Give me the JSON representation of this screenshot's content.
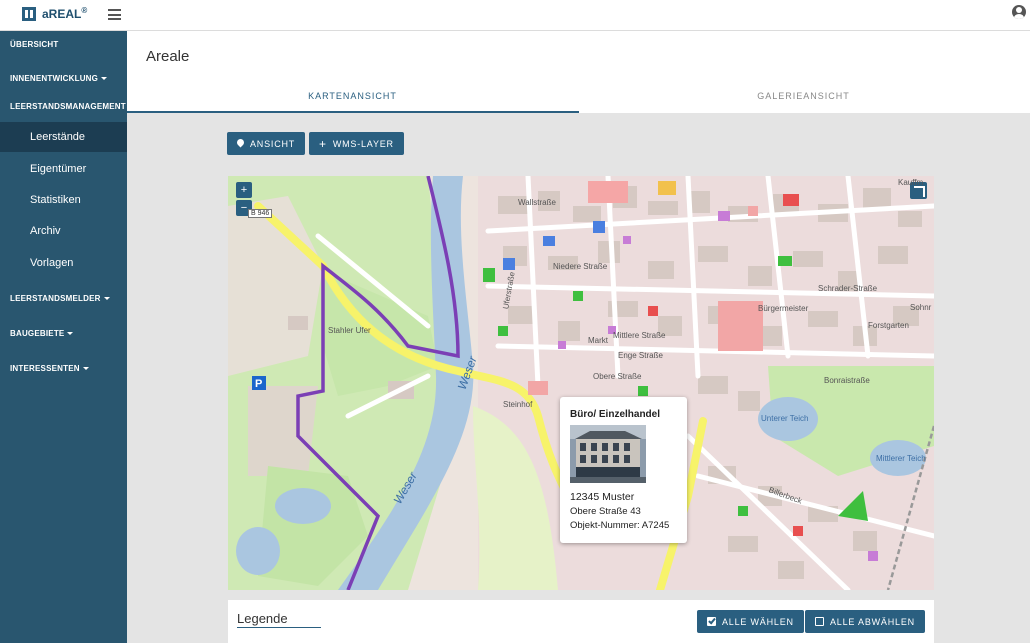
{
  "brand": {
    "name": "aREAL",
    "mark": "®"
  },
  "sidebar": {
    "sections": [
      {
        "label": "ÜBERSICHT"
      },
      {
        "label": "INNENENTWICKLUNG"
      },
      {
        "label": "LEERSTANDSMANAGEMENT"
      },
      {
        "label": "LEERSTANDSMELDER"
      },
      {
        "label": "BAUGEBIETE"
      },
      {
        "label": "INTERESSENTEN"
      }
    ],
    "items": [
      {
        "label": "Leerstände",
        "active": true
      },
      {
        "label": "Eigentümer"
      },
      {
        "label": "Statistiken"
      },
      {
        "label": "Archiv"
      },
      {
        "label": "Vorlagen"
      }
    ]
  },
  "page": {
    "title": "Areale"
  },
  "tabs": [
    {
      "label": "KARTENANSICHT",
      "active": true
    },
    {
      "label": "GALERIEANSICHT"
    }
  ],
  "toolbar": {
    "view_label": "ANSICHT",
    "wms_label": "WMS-LAYER"
  },
  "map": {
    "zoom_in": "+",
    "zoom_out": "−",
    "road_number": "B 946",
    "labels": {
      "stahler_ufer": "Stahler Ufer",
      "weser1": "Weser",
      "weser2": "Weser",
      "markt": "Markt",
      "enge_strasse": "Enge Straße",
      "obere_strasse": "Obere Straße",
      "mittlere_strasse": "Mittlere Straße",
      "wall": "Wallstraße",
      "steinhof": "Steinhof",
      "unterer_teich": "Unterer Teich",
      "mittlerer_teich": "Mittlerer Teich",
      "bonrai": "Bonraistraße",
      "forstgarten": "Forstgarten",
      "sohnr": "Sohnr",
      "kauff": "Kauffm",
      "billerbeck": "Billerbeck",
      "schrader": "Schrader-Straße",
      "buergermeister": "Bürgermeister",
      "niedere": "Niedere Straße",
      "uferstrasse": "Uferstraße"
    },
    "colors": {
      "water": "#aac6e0",
      "park": "#cdebb0",
      "building": "#d9d0c9",
      "residential": "#e8d8d8",
      "boundary": "#7b3fb5",
      "main_road": "#f7f36a"
    }
  },
  "popup": {
    "title": "Büro/ Einzelhandel",
    "city": "12345 Muster",
    "street": "Obere Straße 43",
    "object_number": "Objekt-Nummer: A7245"
  },
  "legend": {
    "title": "Legende",
    "select_all": "ALLE WÄHLEN",
    "deselect_all": "ALLE ABWÄHLEN"
  },
  "theme": {
    "primary": "#2a5f80",
    "sidebar": "#29566f",
    "sidebar_active": "#1c3d52"
  }
}
